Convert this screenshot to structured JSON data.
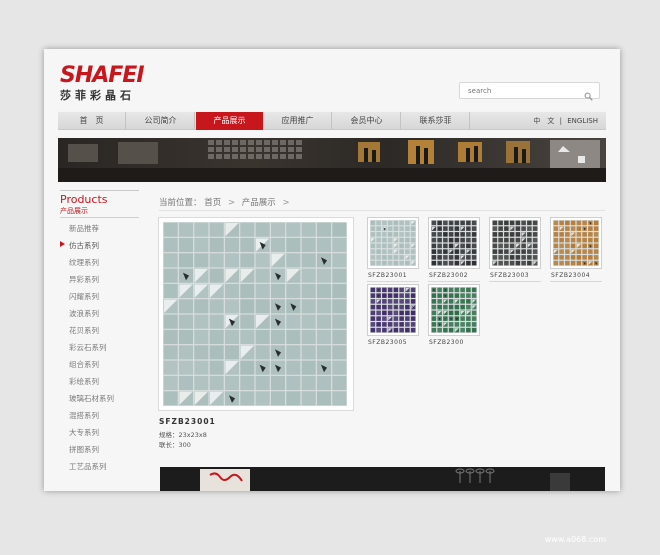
{
  "brand": {
    "logo_text": "SHAFEI",
    "logo_cn": "莎菲彩晶石",
    "accent": "#c8161d"
  },
  "search": {
    "placeholder": "search",
    "icon": "search-icon"
  },
  "nav": {
    "items": [
      {
        "label": "首　页",
        "active": false
      },
      {
        "label": "公司简介",
        "active": false
      },
      {
        "label": "产品展示",
        "active": true
      },
      {
        "label": "应用推广",
        "active": false
      },
      {
        "label": "会员中心",
        "active": false
      },
      {
        "label": "联系莎菲",
        "active": false
      }
    ],
    "lang_cn": "中　文",
    "lang_sep": "|",
    "lang_en": "ENGLISH"
  },
  "sidebar": {
    "title": "Products",
    "subtitle": "产品展示",
    "items": [
      {
        "label": "新品推荐",
        "active": false
      },
      {
        "label": "仿古系列",
        "active": true
      },
      {
        "label": "纹理系列",
        "active": false
      },
      {
        "label": "异彩系列",
        "active": false
      },
      {
        "label": "闪耀系列",
        "active": false
      },
      {
        "label": "波浪系列",
        "active": false
      },
      {
        "label": "花贝系列",
        "active": false
      },
      {
        "label": "彩云石系列",
        "active": false
      },
      {
        "label": "组合系列",
        "active": false
      },
      {
        "label": "彩绘系列",
        "active": false
      },
      {
        "label": "玻璃石材系列",
        "active": false
      },
      {
        "label": "混搭系列",
        "active": false
      },
      {
        "label": "大专系列",
        "active": false
      },
      {
        "label": "拼图系列",
        "active": false
      },
      {
        "label": "工艺品系列",
        "active": false
      }
    ]
  },
  "breadcrumb": {
    "prefix": "当前位置：",
    "items": [
      "首页",
      "产品展示"
    ],
    "sep": ">"
  },
  "product": {
    "code": "SFZB23001",
    "spec_label": "规格：",
    "spec_value": "23x23x8",
    "price_label": "联长：",
    "price_value": "300"
  },
  "thumbnails": [
    {
      "code": "SFZB23001",
      "color": "#a9bdbb"
    },
    {
      "code": "SFZB23002",
      "color": "#2e3033"
    },
    {
      "code": "SFZB23003",
      "color": "#3a3a3a"
    },
    {
      "code": "SFZB23004",
      "color": "#b37a35"
    },
    {
      "code": "SFZB23005",
      "color": "#3e2a66"
    },
    {
      "code": "SFZB2300",
      "color": "#2e6e49"
    }
  ],
  "watermark": "www.a068.com"
}
